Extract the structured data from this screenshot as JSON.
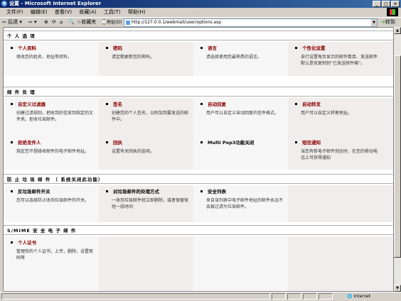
{
  "window": {
    "title": "设置 - Microsoft Internet Explorer"
  },
  "menu": [
    "文件(F)",
    "编辑(E)",
    "查看(V)",
    "收藏(A)",
    "工具(T)",
    "帮助(H)"
  ],
  "toolbar": {
    "back": "后退",
    "favorites": "收藏夹",
    "address_label": "地址(D)",
    "address": "http://127.0.0.1/webmail/user/options.asp",
    "go": "转到"
  },
  "sections": [
    {
      "title": "个 人 选 项",
      "rows": [
        [
          {
            "title": "个人资料",
            "desc": "修改您的姓名、地址等资料。"
          },
          {
            "title": "密码",
            "desc": "请定期更新您的密码。"
          },
          {
            "title": "语言",
            "desc": "请选择使用您最熟悉的语言。"
          },
          {
            "title": "个性化设置",
            "desc": "自行设置每页显示的邮件数目、发送邮件默认是否复制到“已发送邮件箱”。"
          }
        ]
      ]
    },
    {
      "title": "邮 件 处 理",
      "rows": [
        [
          {
            "title": "自定义过滤器",
            "desc": "创建过滤规则，把收到的信放到指定的文件夹。拒收垃圾邮件。"
          },
          {
            "title": "签名",
            "desc": "创建您的个人签名，以附加到要发送的邮件中。"
          },
          {
            "title": "自动回复",
            "desc": "用户可以自定义自动回复的信件格式。"
          },
          {
            "title": "自动转发",
            "desc": "用户可以自定义转寄地址。"
          }
        ],
        [
          {
            "title": "拒绝发件人",
            "desc": "指定您不想接收邮件的电子邮件地址。"
          },
          {
            "title": "回执",
            "desc": "设置有关回执的选项。"
          },
          {
            "title": "Multi Pop3功能关闭",
            "desc": ""
          },
          {
            "title": "短信通知",
            "desc": "当您有新电子邮件到达时，在您的移动电话上可获得通知"
          }
        ]
      ]
    },
    {
      "title": "防 止 垃 圾 邮 件 （ 系统关闭此功能）",
      "rows": [
        [
          {
            "title": "反垃圾邮件开关",
            "desc": "您可以选择防止收到垃圾邮件的开关。"
          },
          {
            "title": "对垃圾邮件的处理方式",
            "desc": "一收到垃圾邮件就立即删除，或者保留很短一段时间"
          },
          {
            "title": "安全列表",
            "desc": "来自该列表中电子邮件地址的邮件永远不会被过滤为垃圾邮件。"
          },
          {
            "title": "",
            "desc": ""
          }
        ]
      ]
    },
    {
      "title": "S/MIME 安 全 电 子 邮 件",
      "rows": [
        [
          {
            "title": "个人证书",
            "desc": "管理你的个人证书，上传，删除，设置密码等"
          },
          {
            "title": "",
            "desc": ""
          },
          {
            "title": "",
            "desc": ""
          },
          {
            "title": "",
            "desc": ""
          }
        ]
      ]
    }
  ],
  "status": {
    "zone": "Internet"
  }
}
